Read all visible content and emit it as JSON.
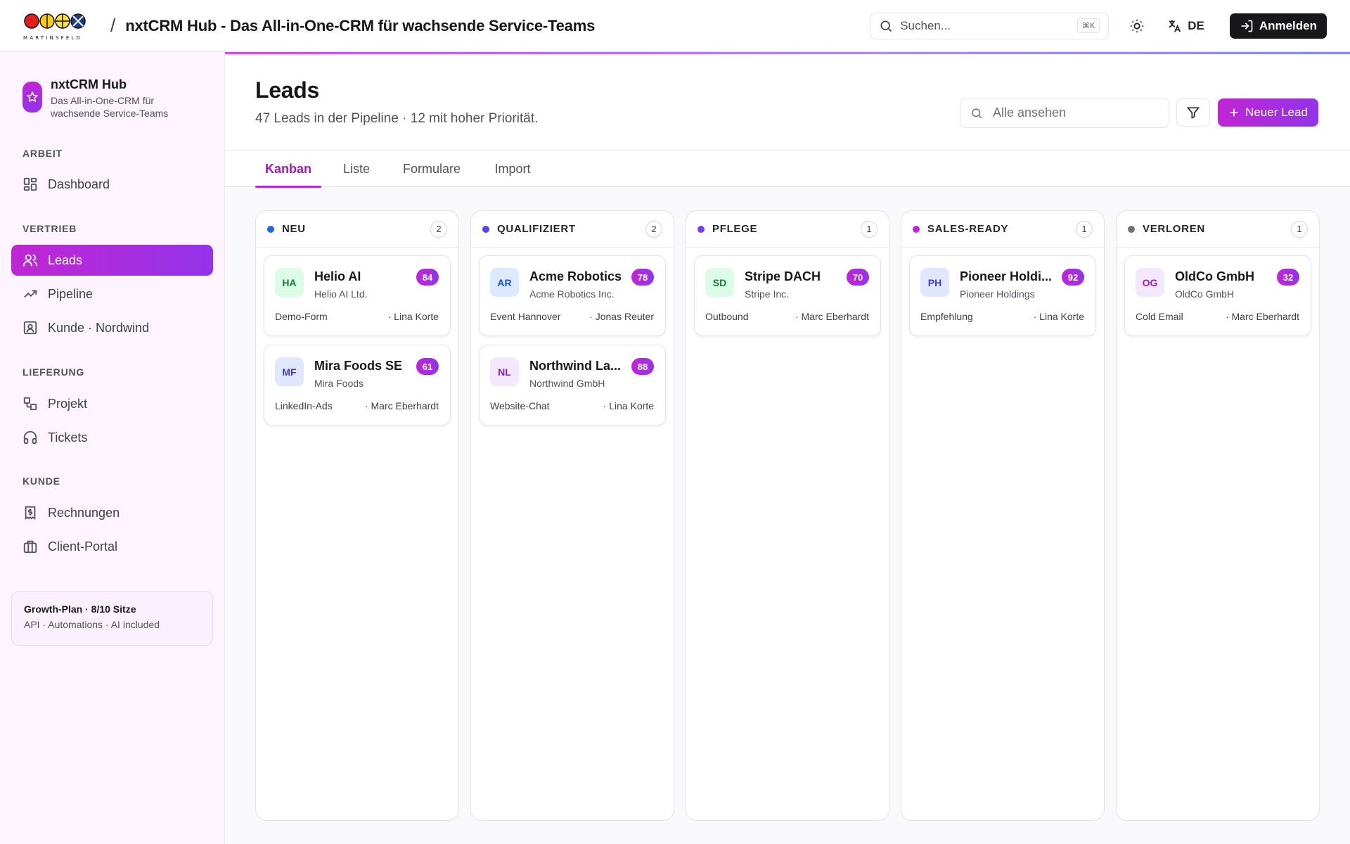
{
  "header": {
    "logo_text": "MARTINSFELD",
    "title": "nxtCRM Hub - Das All-in-One-CRM für wachsende Service-Teams",
    "search_placeholder": "Suchen...",
    "search_shortcut": "⌘K",
    "language": "DE",
    "login_label": "Anmelden"
  },
  "sidebar": {
    "brand_name": "nxtCRM Hub",
    "brand_subtitle": "Das All-in-One-CRM für wachsende Service-Teams",
    "sections": [
      {
        "label": "ARBEIT",
        "items": [
          {
            "label": "Dashboard",
            "icon": "dashboard-icon"
          }
        ]
      },
      {
        "label": "VERTRIEB",
        "items": [
          {
            "label": "Leads",
            "icon": "users-icon",
            "active": true
          },
          {
            "label": "Pipeline",
            "icon": "trending-up-icon"
          },
          {
            "label": "Kunde · Nordwind",
            "icon": "contact-icon"
          }
        ]
      },
      {
        "label": "LIEFERUNG",
        "items": [
          {
            "label": "Projekt",
            "icon": "workflow-icon"
          },
          {
            "label": "Tickets",
            "icon": "headset-icon"
          }
        ]
      },
      {
        "label": "KUNDE",
        "items": [
          {
            "label": "Rechnungen",
            "icon": "invoice-icon"
          },
          {
            "label": "Client-Portal",
            "icon": "briefcase-icon"
          }
        ]
      }
    ],
    "plan_title": "Growth-Plan · 8/10 Sitze",
    "plan_subtitle": "API · Automations · AI included"
  },
  "main": {
    "title": "Leads",
    "subtitle": "47 Leads in der Pipeline · 12 mit hoher Priorität.",
    "search_placeholder": "Alle ansehen",
    "new_lead_label": "Neuer Lead",
    "tabs": [
      {
        "label": "Kanban",
        "active": true
      },
      {
        "label": "Liste"
      },
      {
        "label": "Formulare"
      },
      {
        "label": "Import"
      }
    ]
  },
  "columns": [
    {
      "title": "NEU",
      "count": "2",
      "color": "#2563eb",
      "cards": [
        {
          "initials": "HA",
          "name": "Helio AI",
          "company": "Helio AI Ltd.",
          "score": "84",
          "source": "Demo-Form",
          "owner": "· Lina Korte",
          "avatar_bg": "#dcfce7",
          "avatar_fg": "#15803d"
        },
        {
          "initials": "MF",
          "name": "Mira Foods SE",
          "company": "Mira Foods",
          "score": "61",
          "source": "LinkedIn-Ads",
          "owner": "· Marc Eberhardt",
          "avatar_bg": "#e0e7ff",
          "avatar_fg": "#4338ca"
        }
      ]
    },
    {
      "title": "QUALIFIZIERT",
      "count": "2",
      "color": "#4f46e5",
      "cards": [
        {
          "initials": "AR",
          "name": "Acme Robotics",
          "company": "Acme Robotics Inc.",
          "score": "78",
          "source": "Event Hannover",
          "owner": "· Jonas Reuter",
          "avatar_bg": "#dbeafe",
          "avatar_fg": "#1d4ed8"
        },
        {
          "initials": "NL",
          "name": "Northwind La...",
          "company": "Northwind GmbH",
          "score": "88",
          "source": "Website-Chat",
          "owner": "· Lina Korte",
          "avatar_bg": "#f3e8ff",
          "avatar_fg": "#7e22ce"
        }
      ]
    },
    {
      "title": "PFLEGE",
      "count": "1",
      "color": "#7c3aed",
      "cards": [
        {
          "initials": "SD",
          "name": "Stripe DACH",
          "company": "Stripe Inc.",
          "score": "70",
          "source": "Outbound",
          "owner": "· Marc Eberhardt",
          "avatar_bg": "#dcfce7",
          "avatar_fg": "#15803d"
        }
      ]
    },
    {
      "title": "SALES-READY",
      "count": "1",
      "color": "#c026d3",
      "cards": [
        {
          "initials": "PH",
          "name": "Pioneer Holdi...",
          "company": "Pioneer Holdings",
          "score": "92",
          "source": "Empfehlung",
          "owner": "· Lina Korte",
          "avatar_bg": "#e0e7ff",
          "avatar_fg": "#4338ca"
        }
      ]
    },
    {
      "title": "VERLOREN",
      "count": "1",
      "color": "#71717a",
      "cards": [
        {
          "initials": "OG",
          "name": "OldCo GmbH",
          "company": "OldCo GmbH",
          "score": "32",
          "source": "Cold Email",
          "owner": "· Marc Eberhardt",
          "avatar_bg": "#f3e8ff",
          "avatar_fg": "#a21caf"
        }
      ]
    }
  ]
}
